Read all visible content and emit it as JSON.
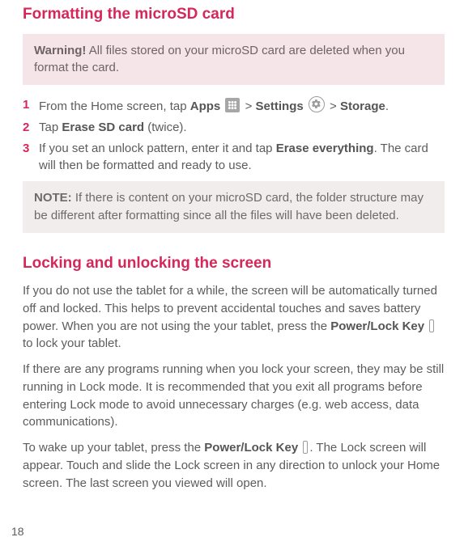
{
  "section1": {
    "title": "Formatting the microSD card",
    "warning_label": "Warning!",
    "warning_text": " All files stored on your microSD card are deleted when you format the card.",
    "steps": {
      "s1_a": "From the Home screen, tap ",
      "s1_apps": "Apps",
      "s1_gt1": " > ",
      "s1_settings": "Settings",
      "s1_gt2": " > ",
      "s1_storage": "Storage",
      "s1_end": ".",
      "s2_a": "Tap ",
      "s2_b": "Erase SD card",
      "s2_c": " (twice).",
      "s3_a": "If you set an unlock pattern, enter it and tap ",
      "s3_b": "Erase everything",
      "s3_c": ". The card will then be formatted and ready to use."
    },
    "note_label": "NOTE:",
    "note_text": " If there is content on your microSD card, the folder structure may be different after formatting since all the files will have been deleted."
  },
  "section2": {
    "title": "Locking and unlocking the screen",
    "p1_a": "If you do not use the tablet for a while, the screen will be automatically turned off and locked. This helps to prevent accidental touches and saves battery power. When you are not using the your tablet, press the ",
    "p1_b": "Power/Lock Key",
    "p1_c": " to lock your tablet.",
    "p2": "If there are any programs running when you lock your screen, they may be still running in Lock mode. It is recommended that you exit all programs before entering Lock mode to avoid unnecessary charges (e.g. web access, data communications).",
    "p3_a": "To wake up your tablet, press the ",
    "p3_b": "Power/Lock Key",
    "p3_c": ". The Lock screen will appear. Touch and slide the Lock screen in any direction to unlock your Home screen. The last screen you viewed will open."
  },
  "page_number": "18"
}
